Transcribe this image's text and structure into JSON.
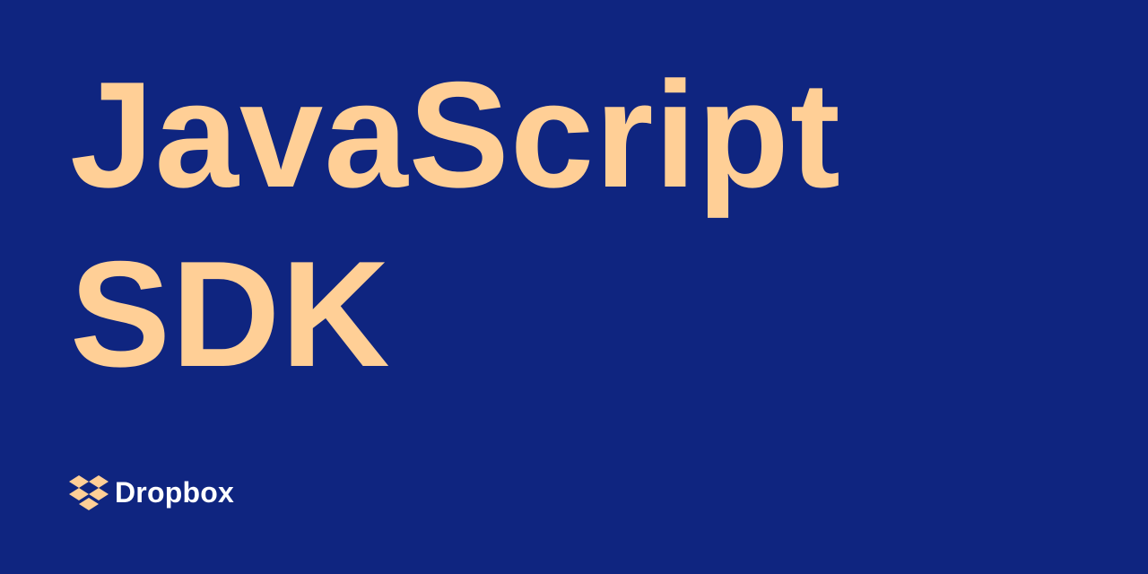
{
  "banner": {
    "title_line_1": "JavaScript",
    "title_line_2": "SDK",
    "background_color": "#0f2580",
    "title_color": "#ffcf96"
  },
  "brand": {
    "name": "Dropbox",
    "icon": "dropbox-logo-icon",
    "icon_color": "#ffcf96",
    "name_color": "#ffffff"
  }
}
